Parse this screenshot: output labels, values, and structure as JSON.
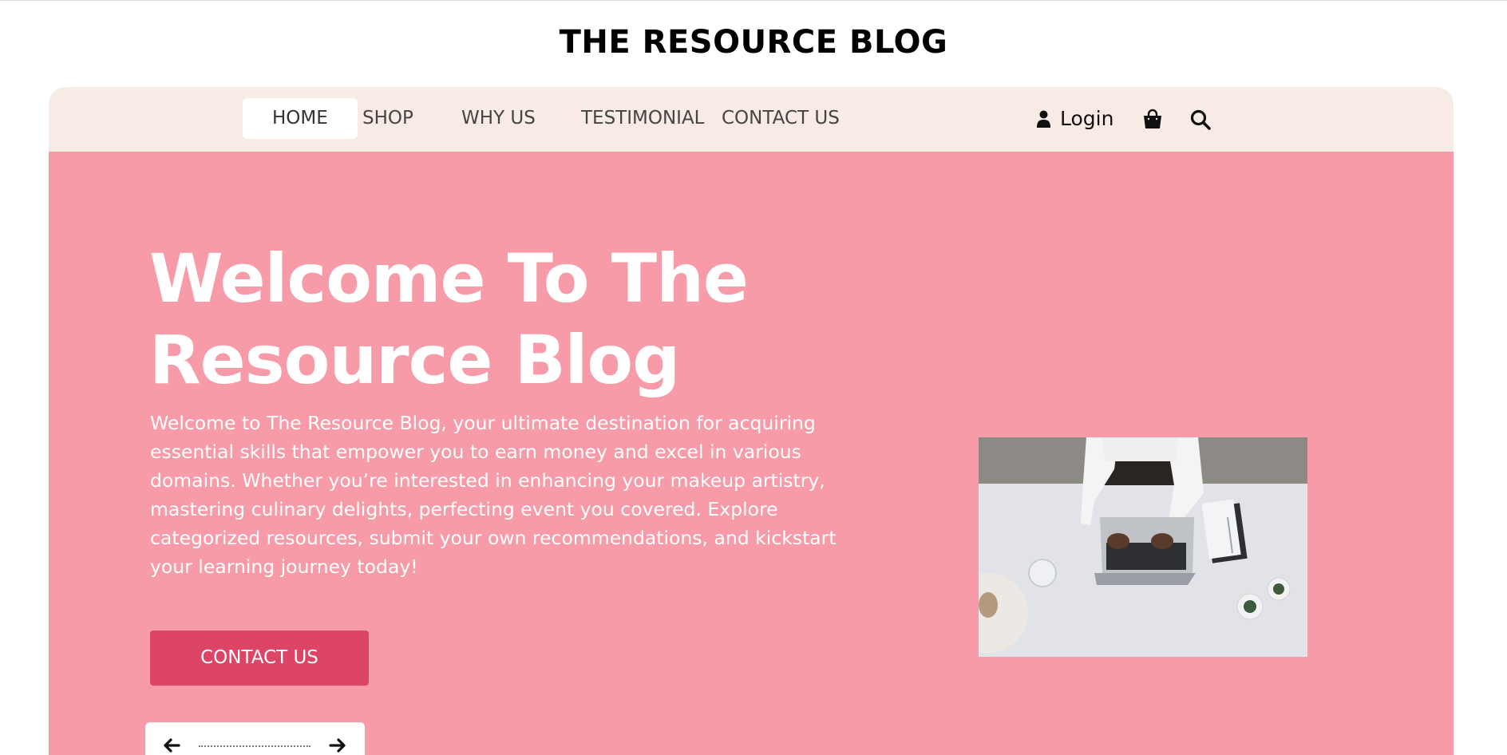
{
  "site": {
    "title": "THE RESOURCE BLOG"
  },
  "nav": {
    "items": [
      {
        "label": "HOME",
        "active": true
      },
      {
        "label": "SHOP",
        "active": false
      },
      {
        "label": "WHY US",
        "active": false
      },
      {
        "label": "TESTIMONIAL",
        "active": false
      },
      {
        "label": "CONTACT US",
        "active": false
      }
    ],
    "login_label": "Login",
    "icons": [
      "user-icon",
      "shopping-bag-icon",
      "search-icon"
    ]
  },
  "hero": {
    "title_line1": "Welcome To The",
    "title_line2": "Resource Blog",
    "text": "Welcome to The Resource Blog, your ultimate destination for acquiring essential skills that empower you to earn money and excel in various domains. Whether you’re interested in enhancing your makeup artistry, mastering culinary delights, perfecting event you covered. Explore categorized resources, submit your own recommendations, and kickstart your learning journey today!",
    "cta_label": "CONTACT US",
    "slider_icons": [
      "arrow-left-icon",
      "arrow-right-icon"
    ]
  },
  "colors": {
    "nav_bg": "#f8ebe5",
    "hero_bg": "#f79ba9",
    "cta_bg": "#dd4567",
    "text_light": "#ffffff"
  }
}
